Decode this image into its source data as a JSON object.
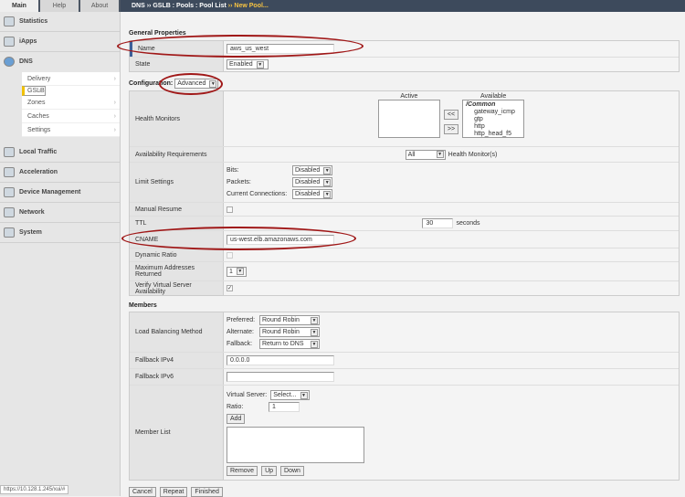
{
  "tabs": [
    "Main",
    "Help",
    "About"
  ],
  "breadcrumb": {
    "path": "DNS  ››  GSLB : Pools : Pool List",
    "sep": "››",
    "current": "New Pool..."
  },
  "sidebar": {
    "items": [
      {
        "label": "Statistics"
      },
      {
        "label": "iApps"
      },
      {
        "label": "DNS"
      }
    ],
    "dns_sub": [
      "Delivery",
      "GSLB",
      "Zones",
      "Caches",
      "Settings"
    ],
    "items2": [
      {
        "label": "Local Traffic"
      },
      {
        "label": "Acceleration"
      },
      {
        "label": "Device Management"
      },
      {
        "label": "Network"
      },
      {
        "label": "System"
      }
    ]
  },
  "general": {
    "title": "General Properties",
    "name_label": "Name",
    "name_value": "aws_us_west",
    "state_label": "State",
    "state_value": "Enabled"
  },
  "config": {
    "label": "Configuration:",
    "value": "Advanced",
    "health_label": "Health Monitors",
    "active_label": "Active",
    "available_label": "Available",
    "available": [
      "/Common",
      "gateway_icmp",
      "gtp",
      "http",
      "http_head_f5"
    ],
    "move_left": "<<",
    "move_right": ">>",
    "avail_label": "Availability Requirements",
    "avail_value": "All",
    "avail_suffix": "Health Monitor(s)",
    "limit_label": "Limit Settings",
    "bits": "Bits:",
    "packets": "Packets:",
    "conns": "Current Connections:",
    "disabled": "Disabled",
    "manual_label": "Manual Resume",
    "ttl_label": "TTL",
    "ttl_value": "30",
    "ttl_unit": "seconds",
    "cname_label": "CNAME",
    "cname_value": "us-west.elb.amazonaws.com",
    "dyn_label": "Dynamic Ratio",
    "max_label": "Maximum Addresses Returned",
    "max_value": "1",
    "verify_label": "Verify Virtual Server Availability",
    "verify_check": "✓"
  },
  "members": {
    "title": "Members",
    "lb_label": "Load Balancing Method",
    "preferred": "Preferred:",
    "alternate": "Alternate:",
    "fallback": "Fallback:",
    "preferred_value": "Round Robin",
    "alternate_value": "Round Robin",
    "fallback_value": "Return to DNS",
    "ipv4_label": "Fallback IPv4",
    "ipv4_value": "0.0.0.0",
    "ipv6_label": "Fallback IPv6",
    "ml_label": "Member List",
    "vs_label": "Virtual Server:",
    "vs_value": "Select...",
    "ratio_label": "Ratio:",
    "ratio_value": "1",
    "add": "Add",
    "remove": "Remove",
    "up": "Up",
    "down": "Down"
  },
  "actions": {
    "cancel": "Cancel",
    "repeat": "Repeat",
    "finished": "Finished"
  },
  "status_url": "https://10.128.1.245/xui/#"
}
